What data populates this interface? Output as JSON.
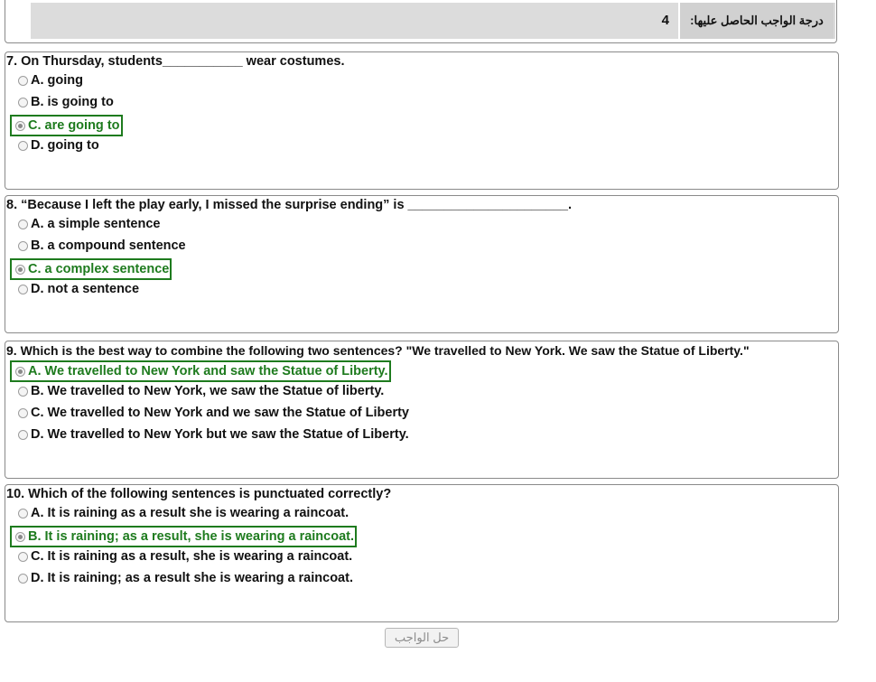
{
  "score": {
    "label": "درجة الواجب الحاصل عليها:",
    "value": "4"
  },
  "questions": [
    {
      "text": "7. On Thursday, students___________ wear costumes.",
      "options": [
        "A. going",
        "B. is going to",
        "C. are going to",
        "D. going to"
      ],
      "selected": 2
    },
    {
      "text": "8. “Because I left the play early, I missed the surprise ending” is ______________________.",
      "options": [
        "A. a simple sentence",
        "B. a compound sentence",
        "C. a complex sentence",
        "D. not a sentence"
      ],
      "selected": 2
    },
    {
      "text": "9. Which is the best way to combine the following two sentences? \"We travelled to New York. We saw the Statue of Liberty.\"",
      "options": [
        "A. We travelled to New York and saw the Statue of Liberty.",
        "B. We travelled to New York, we saw the Statue of liberty.",
        "C. We travelled to New York and we saw the Statue of Liberty",
        "D. We travelled to New York but we saw the Statue of Liberty."
      ],
      "selected": 0
    },
    {
      "text": "10. Which of the following sentences is punctuated correctly?",
      "options": [
        "A. It is raining as a result she is wearing a raincoat.",
        "B. It is raining; as a result, she is wearing a raincoat.",
        "C. It is raining as a result, she is wearing a raincoat.",
        "D. It is raining; as a result she is wearing a raincoat."
      ],
      "selected": 1
    }
  ],
  "submit_label": "حل الواجب",
  "colors": {
    "selected": "#1e7b1e",
    "border": "#8a8a8a",
    "header_bg": "#dcdcdc"
  }
}
